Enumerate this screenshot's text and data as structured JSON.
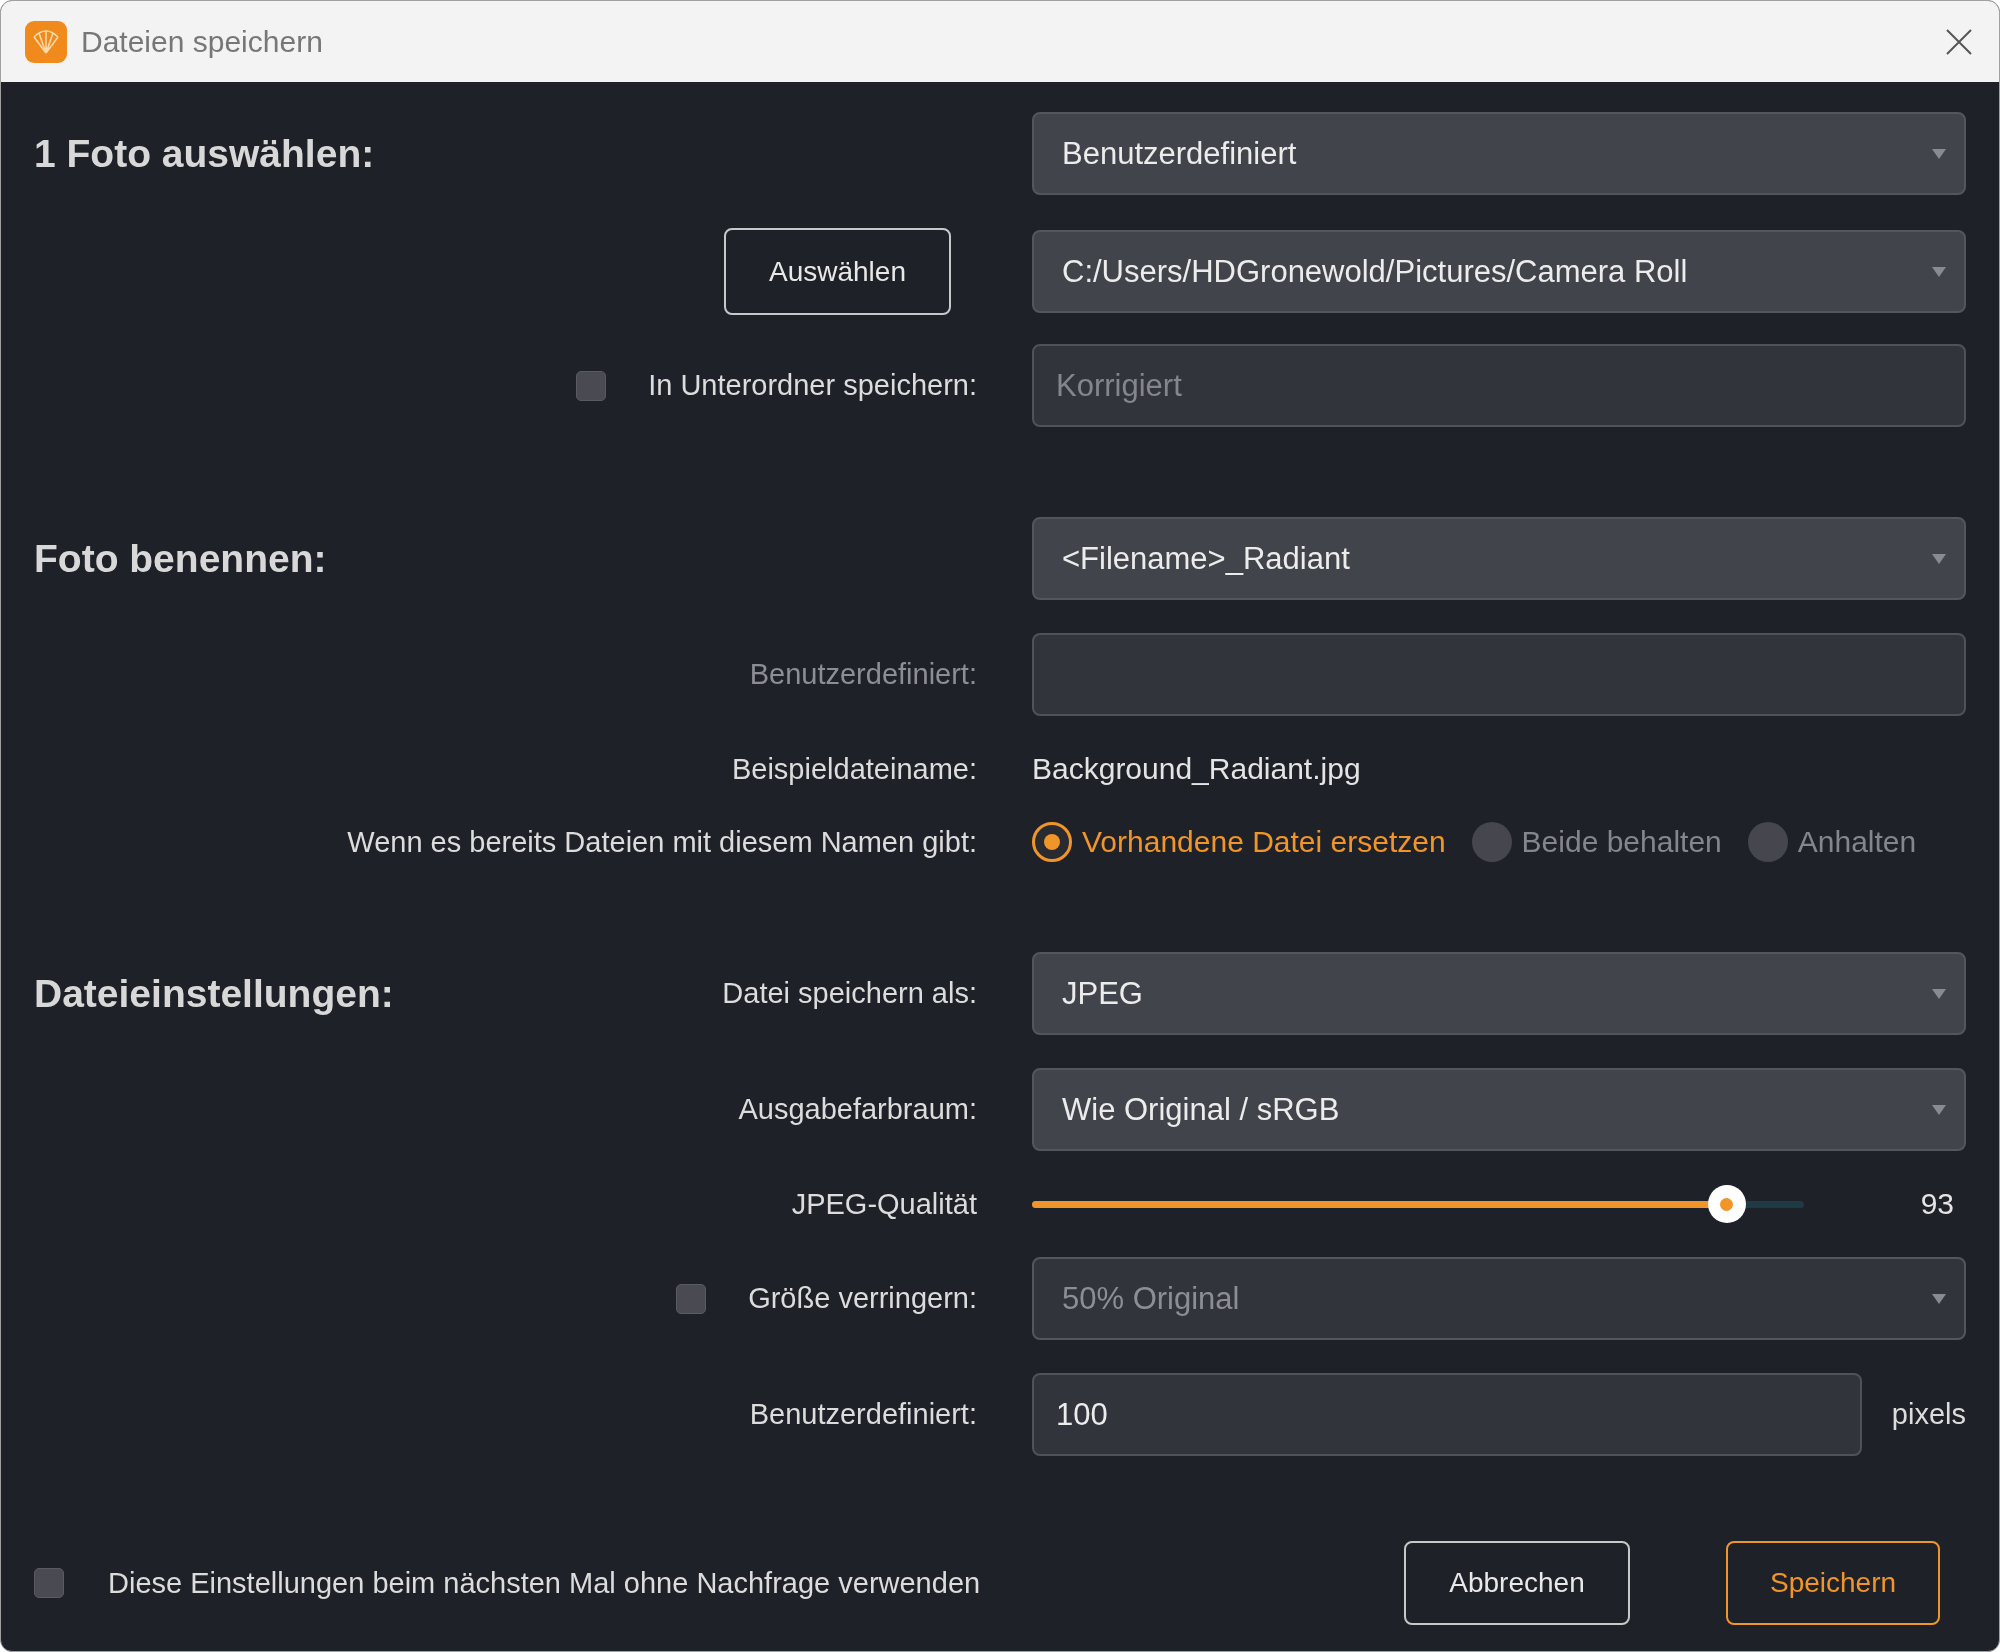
{
  "window": {
    "title": "Dateien speichern"
  },
  "sections": [
    {
      "heading": "1 Foto auswählen:",
      "rows": [
        {
          "kind": "dropdown",
          "value": "Benutzerdefiniert"
        },
        {
          "kind": "dropdown",
          "button": "Auswählen",
          "value": "C:/Users/HDGronewold/Pictures/Camera Roll"
        },
        {
          "kind": "input",
          "checkbox": {
            "label": "In Unterordner speichern:",
            "checked": false
          },
          "placeholder": "Korrigiert"
        }
      ]
    },
    {
      "heading": "Foto benennen:",
      "rows": [
        {
          "kind": "dropdown",
          "value": "<Filename>_Radiant"
        },
        {
          "kind": "input",
          "label": "Benutzerdefiniert:",
          "disabled": true
        },
        {
          "kind": "text",
          "label": "Beispieldateiname:",
          "value": "Background_Radiant.jpg"
        },
        {
          "kind": "radio",
          "label": "Wenn es bereits Dateien mit diesem Namen gibt:",
          "options": [
            {
              "label": "Vorhandene Datei ersetzen",
              "selected": true
            },
            {
              "label": "Beide behalten",
              "selected": false
            },
            {
              "label": "Anhalten",
              "selected": false
            }
          ]
        }
      ]
    },
    {
      "heading": "Dateieinstellungen:",
      "rows": [
        {
          "kind": "dropdown",
          "label": "Datei speichern als:",
          "value": "JPEG"
        },
        {
          "kind": "dropdown",
          "label": "Ausgabefarbraum:",
          "value": "Wie Original / sRGB"
        },
        {
          "kind": "slider",
          "label": "JPEG-Qualität",
          "level": 0.9,
          "reading": "93"
        },
        {
          "kind": "dropdown",
          "checkbox": {
            "label": "Größe verringern:",
            "checked": false
          },
          "value": "50% Original",
          "disabled": true
        },
        {
          "kind": "input",
          "label": "Benutzerdefiniert:",
          "value": "100",
          "suffix": "pixels"
        }
      ]
    }
  ],
  "footer": {
    "checkbox": {
      "label": "Diese Einstellungen beim nächsten Mal ohne Nachfrage verwenden",
      "checked": false
    },
    "buttons": [
      {
        "label": "Abbrechen",
        "primary": false
      },
      {
        "label": "Speichern",
        "primary": true
      }
    ]
  }
}
